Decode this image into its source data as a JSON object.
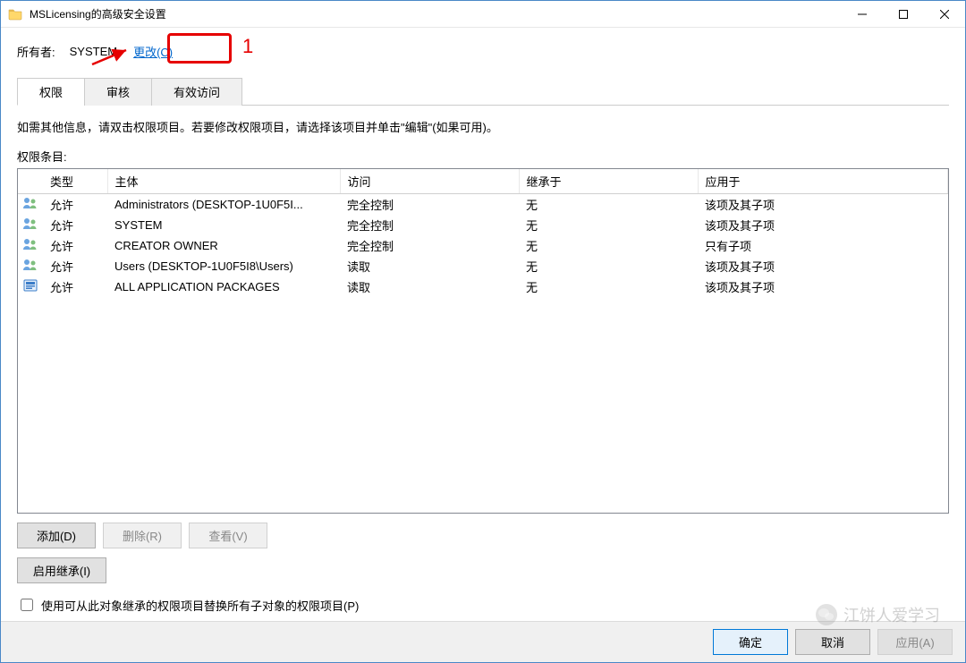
{
  "window": {
    "title": "MSLicensing的高级安全设置"
  },
  "owner": {
    "label": "所有者:",
    "value": "SYSTEM",
    "change_label": "更改(C)"
  },
  "annotation": {
    "marker": "1"
  },
  "tabs": {
    "permissions": "权限",
    "auditing": "审核",
    "effective": "有效访问"
  },
  "hint": "如需其他信息，请双击权限项目。若要修改权限项目，请选择该项目并单击\"编辑\"(如果可用)。",
  "entries_label": "权限条目:",
  "columns": {
    "type": "类型",
    "principal": "主体",
    "access": "访问",
    "inherited_from": "继承于",
    "applies_to": "应用于"
  },
  "rows": [
    {
      "icon": "users",
      "type": "允许",
      "principal": "Administrators (DESKTOP-1U0F5I...",
      "access": "完全控制",
      "inherited": "无",
      "applies": "该项及其子项"
    },
    {
      "icon": "users",
      "type": "允许",
      "principal": "SYSTEM",
      "access": "完全控制",
      "inherited": "无",
      "applies": "该项及其子项"
    },
    {
      "icon": "users",
      "type": "允许",
      "principal": "CREATOR OWNER",
      "access": "完全控制",
      "inherited": "无",
      "applies": "只有子项"
    },
    {
      "icon": "users",
      "type": "允许",
      "principal": "Users (DESKTOP-1U0F5I8\\Users)",
      "access": "读取",
      "inherited": "无",
      "applies": "该项及其子项"
    },
    {
      "icon": "package",
      "type": "允许",
      "principal": "ALL APPLICATION PACKAGES",
      "access": "读取",
      "inherited": "无",
      "applies": "该项及其子项"
    }
  ],
  "buttons": {
    "add": "添加(D)",
    "remove": "删除(R)",
    "view": "查看(V)",
    "enable_inherit": "启用继承(I)"
  },
  "checkbox": {
    "replace_label": "使用可从此对象继承的权限项目替换所有子对象的权限项目(P)"
  },
  "footer": {
    "ok": "确定",
    "cancel": "取消",
    "apply": "应用(A)"
  },
  "watermark": {
    "text": "江饼人爱学习"
  }
}
